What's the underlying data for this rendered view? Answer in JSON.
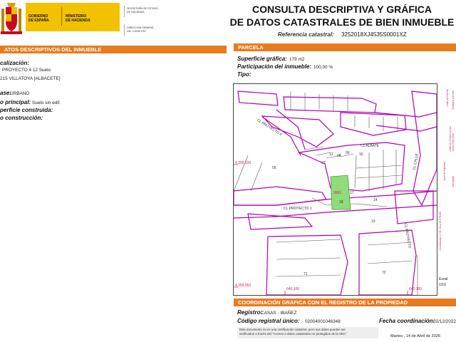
{
  "header": {
    "gov_line1": "GOBIERNO",
    "gov_line2": "DE ESPAÑA",
    "ministry_line1": "MINISTERIO",
    "ministry_line2": "DE HACIENDA",
    "secretaria_line1": "SECRETARÍA DE ESTADO",
    "secretaria_line2": "DE HACIENDA",
    "direccion_line1": "DIRECCIÓN GENERAL",
    "direccion_line2": "DEL CATASTRO",
    "title_line1": "CONSULTA DESCRIPTIVA Y GRÁFICA",
    "title_line2": "DE DATOS CATASTRALES DE BIEN INMUEBLE",
    "ref_label": "Referencia catastral:",
    "ref_value": "3252018XJ4535S0001XZ"
  },
  "left": {
    "section_title": "ATOS DESCRIPTIVOS DEL INMUEBLE",
    "localizacion_label": "calización:",
    "localizacion_line1": "PROYECTO 4 12 Suelo",
    "localizacion_line2": "215 VILLATOYA [ALBACETE]",
    "clase_label": "ase:",
    "clase_value": "URBANO",
    "uso_label": "o principal:",
    "uso_value": "Suelo sin edif.",
    "superficie_label": "perficie construida:",
    "anio_label": "o construcción:"
  },
  "parcela": {
    "section_title": "PARCELA",
    "superficie_label": "Superficie gráfica:",
    "superficie_value": "179 m2",
    "participacion_label": "Participación del inmueble:",
    "participacion_value": "100,00 %",
    "tipo_label": "Tipo:"
  },
  "map": {
    "streets": [
      "CL PROYECTO 1",
      "CL PROYECTO 4",
      "CL ALBATE",
      "CL CALLE",
      "CL PROYECTO"
    ],
    "parcel_numbers": [
      "05",
      "07",
      "08",
      "09",
      "17",
      "18",
      "14",
      "19",
      "71",
      "72",
      "16",
      "13"
    ],
    "highlight_label": "3962",
    "coord_labels": [
      "4.355.100",
      "4.355.050",
      "640.100",
      "640.150"
    ],
    "scale_label_1": "Escal",
    "scale_label_2": "1/10",
    "side_text_1": "Coordenadas U.T.M. Huso 30 ETRS89",
    "side_text_2": "Límite de Manzana",
    "side_text_3": "Límite de Parcela",
    "side_text_4": "Límite de Construcciones",
    "side_text_5": "Mobiliario y aceras",
    "side_text_6": "Límite zona verde",
    "side_text_7": "Hidrografía"
  },
  "registro": {
    "section_title": "COORDINACIÓN GRÁFICA CON EL REGISTRO DE LA PROPIEDAD",
    "registro_label": "Registro:",
    "registro_value": "CASAS - IBAÑEZ",
    "codigo_label": "Código registral único:",
    "codigo_value": "02004001046348",
    "fecha_label": "Fecha coordinación:",
    "fecha_value": "02/12/2022",
    "note_line1": "Este documento no es una certificación catastral, pero sus datos pueden ser",
    "note_line2": "verificados a través del \"Acceso a datos catastrales no protegidos de la SEC\"",
    "date_footer": "Martes , 14 de Abril de 2026"
  },
  "colors": {
    "accent": "#e87b1e",
    "map_line": "#b000b0",
    "highlight": "#8fdc7a"
  }
}
